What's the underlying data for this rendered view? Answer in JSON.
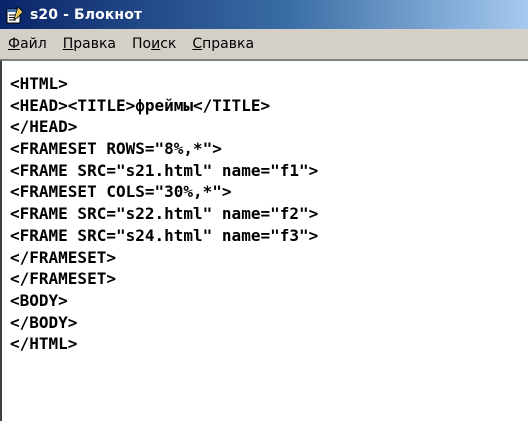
{
  "window": {
    "title": "s20 - Блокнот",
    "icon": "notepad-icon"
  },
  "menu": {
    "items": [
      {
        "accel": "Ф",
        "rest": "айл"
      },
      {
        "accel": "П",
        "rest": "равка"
      },
      {
        "pre": "По",
        "accel": "и",
        "rest": "ск"
      },
      {
        "accel": "С",
        "rest": "правка"
      }
    ]
  },
  "editor": {
    "lines": [
      "<HTML>",
      "<HEAD><TITLE>фреймы</TITLE>",
      "</HEAD>",
      "<FRAMESET ROWS=\"8%,*\">",
      "<FRAME SRC=\"s21.html\" name=\"f1\">",
      "<FRAMESET COLS=\"30%,*\">",
      "<FRAME SRC=\"s22.html\" name=\"f2\">",
      "<FRAME SRC=\"s24.html\" name=\"f3\">",
      "</FRAMESET>",
      "</FRAMESET>",
      "<BODY>",
      "</BODY>",
      "</HTML>"
    ]
  },
  "colors": {
    "titlebar_start": "#0a246a",
    "titlebar_end": "#a6caf0",
    "menubar_bg": "#d4d0c8",
    "editor_bg": "#ffffff",
    "text": "#000000"
  }
}
